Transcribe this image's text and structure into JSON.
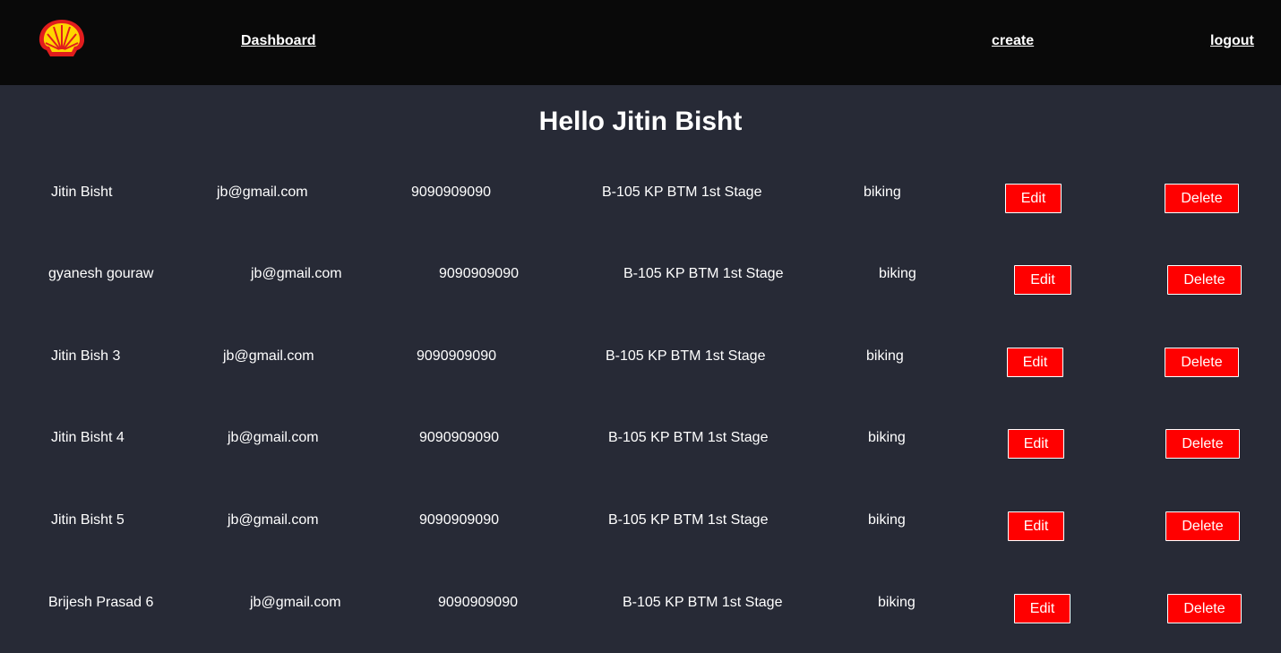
{
  "nav": {
    "logo_icon": "shell-logo-icon",
    "dashboard": "Dashboard",
    "create": "create",
    "logout": "logout"
  },
  "greeting": "Hello Jitin Bisht",
  "colors": {
    "navbar": "#090909",
    "background": "#272a36",
    "button": "#ff0000",
    "logo_red": "#e11d1d",
    "logo_yellow": "#ffd500"
  },
  "users": [
    {
      "name": "Jitin Bisht",
      "email": "jb@gmail.com",
      "phone": "9090909090",
      "address": "B-105 KP BTM 1st Stage",
      "hobby": "biking",
      "edit": "Edit",
      "delete": "Delete"
    },
    {
      "name": "gyanesh gouraw",
      "email": "jb@gmail.com",
      "phone": "9090909090",
      "address": "B-105 KP BTM 1st Stage",
      "hobby": "biking",
      "edit": "Edit",
      "delete": "Delete"
    },
    {
      "name": "Jitin Bish 3",
      "email": "jb@gmail.com",
      "phone": "9090909090",
      "address": "B-105 KP BTM 1st Stage",
      "hobby": "biking",
      "edit": "Edit",
      "delete": "Delete"
    },
    {
      "name": "Jitin Bisht 4",
      "email": "jb@gmail.com",
      "phone": "9090909090",
      "address": "B-105 KP BTM 1st Stage",
      "hobby": "biking",
      "edit": "Edit",
      "delete": "Delete"
    },
    {
      "name": "Jitin Bisht 5",
      "email": "jb@gmail.com",
      "phone": "9090909090",
      "address": "B-105 KP BTM 1st Stage",
      "hobby": "biking",
      "edit": "Edit",
      "delete": "Delete"
    },
    {
      "name": "Brijesh Prasad 6",
      "email": "jb@gmail.com",
      "phone": "9090909090",
      "address": "B-105 KP BTM 1st Stage",
      "hobby": "biking",
      "edit": "Edit",
      "delete": "Delete"
    }
  ]
}
